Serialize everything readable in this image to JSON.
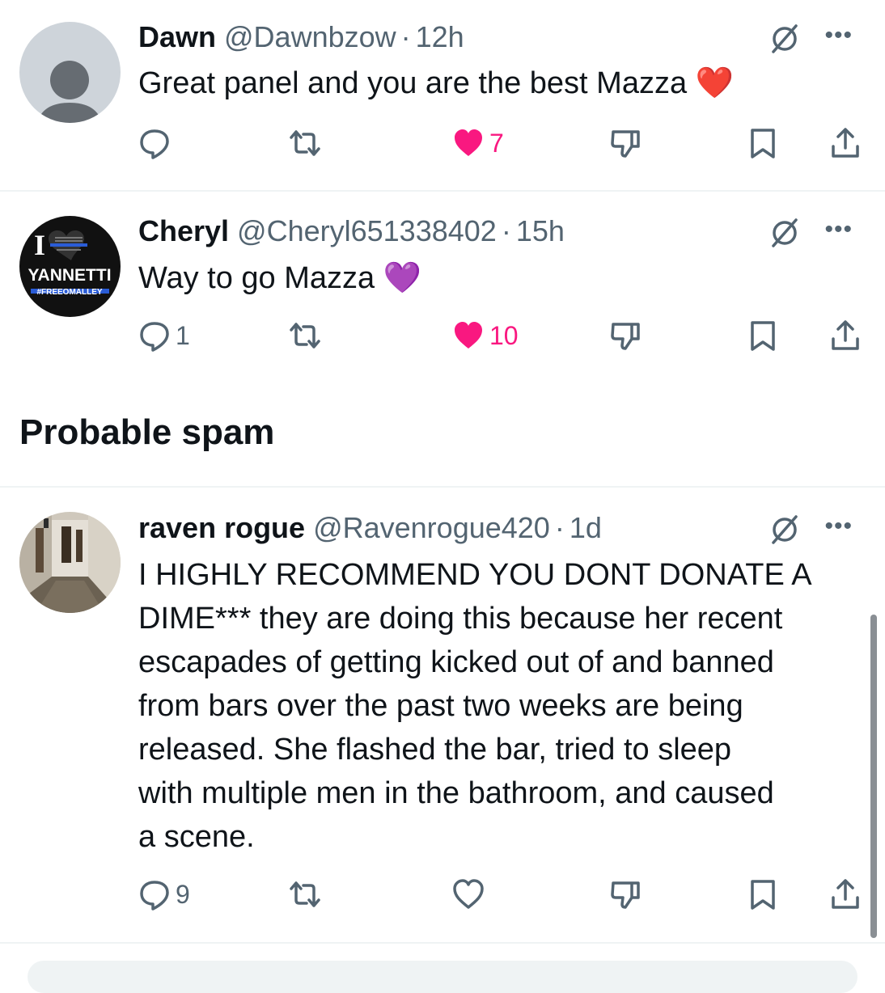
{
  "tweets": [
    {
      "name": "Dawn",
      "handle": "@Dawnbzow",
      "time": "12h",
      "text": "Great panel and you are the best Mazza",
      "emoji": "❤️",
      "replies": "",
      "likes": "7",
      "liked": true,
      "avatar": "default-avatar"
    },
    {
      "name": "Cheryl",
      "handle": "@Cheryl651338402",
      "time": "15h",
      "text": "Way to go Mazza",
      "emoji": "💜",
      "replies": "1",
      "likes": "10",
      "liked": true,
      "avatar": {
        "line1": "I",
        "line2": "YANNETTI",
        "line3": "#FREEOMALLEY"
      }
    }
  ],
  "section": {
    "title": "Probable spam"
  },
  "spam_tweet": {
    "name": "raven rogue",
    "handle": "@Ravenrogue420",
    "time": "1d",
    "lines": [
      "I HIGHLY RECOMMEND YOU DONT DONATE A",
      "DIME*** they are doing this because her recent",
      "escapades of getting kicked out of and banned",
      "from bars over the past two weeks are being",
      "released. She flashed the bar, tried to sleep",
      "with multiple men in the bathroom, and caused",
      "a scene."
    ],
    "replies": "9",
    "likes": "",
    "liked": false,
    "avatar": "photo-hallway"
  },
  "icons": [
    "reply-icon",
    "retweet-icon",
    "like-icon",
    "dislike-icon",
    "bookmark-icon",
    "share-icon",
    "grok-icon",
    "more-icon"
  ],
  "colors": {
    "like": "#f91880",
    "secondary": "#536471",
    "text": "#0f1419",
    "divider": "#eff3f4"
  }
}
